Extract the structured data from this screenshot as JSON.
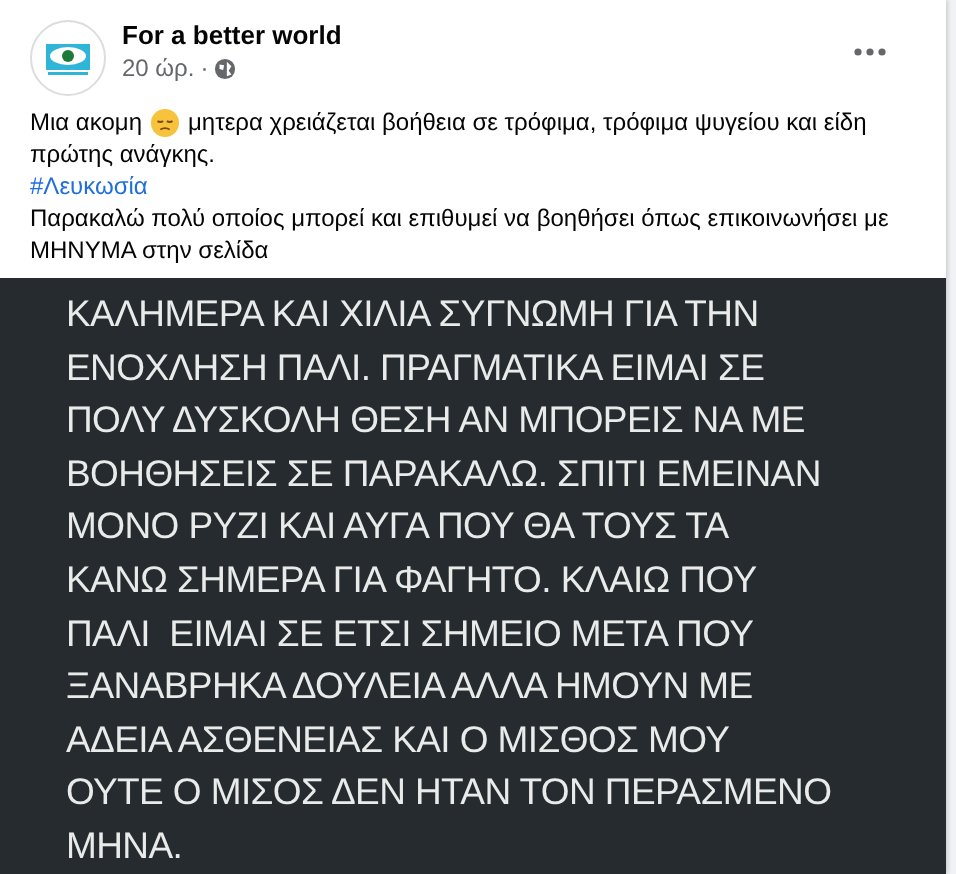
{
  "post": {
    "author": "For a better world",
    "time": "20 ώρ.",
    "separator": "·",
    "text_before_emoji": "Μια ακομη",
    "text_after_emoji": "μητερα χρειάζεται βοήθεια σε τρόφιμα, τρόφιμα ψυγείου και είδη",
    "text_continued": "πρώτης ανάγκης.",
    "hashtag": "#Λευκωσία",
    "request": "Παρακαλώ πολύ οποίος μπορεί και επιθυμεί να βοηθήσει όπως επικοινωνήσει με ΜΗΝΥΜΑ στην σελίδα"
  },
  "image": {
    "lines": [
      "ΚΑΛΗΜΕΡΑ ΚΑΙ ΧΙΛΙΑ ΣΥΓΝΩΜΗ ΓΙΑ ΤΗΝ",
      "ΕΝΟΧΛΗΣΗ ΠΑΛΙ. ΠΡΑΓΜΑΤΙΚΑ ΕΙΜΑΙ ΣΕ",
      "ΠΟΛΥ ΔΥΣΚΟΛΗ ΘΕΣΗ ΑΝ ΜΠΟΡΕΙΣ ΝΑ ΜΕ",
      "ΒΟΗΘΗΣΕΙΣ ΣΕ ΠΑΡΑΚΑΛΩ. ΣΠΙΤΙ ΕΜΕΙΝΑΝ",
      "ΜΟΝΟ ΡΥΖΙ ΚΑΙ ΑΥΓΑ ΠΟΥ ΘΑ ΤΟΥΣ ΤΑ",
      "ΚΑΝΩ ΣΗΜΕΡΑ ΓΙΑ ΦΑΓΗΤΟ. ΚΛΑΙΩ ΠΟΥ",
      "ΠΑΛΙ  ΕΙΜΑΙ ΣΕ ΕΤΣΙ ΣΗΜΕΙΟ ΜΕΤΑ ΠΟΥ",
      "ΞΑΝΑΒΡΗΚΑ ΔΟΥΛΕΙΑ ΑΛΛΑ ΗΜΟΥΝ ΜΕ",
      "ΑΔΕΙΑ ΑΣΘΕΝΕΙΑΣ ΚΑΙ Ο ΜΙΣΘΟΣ ΜΟΥ",
      "ΟΥΤΕ Ο ΜΙΣΟΣ ΔΕΝ ΗΤΑΝ ΤΟΝ ΠΕΡΑΣΜΕΝΟ",
      "ΜΗΝΑ."
    ]
  }
}
